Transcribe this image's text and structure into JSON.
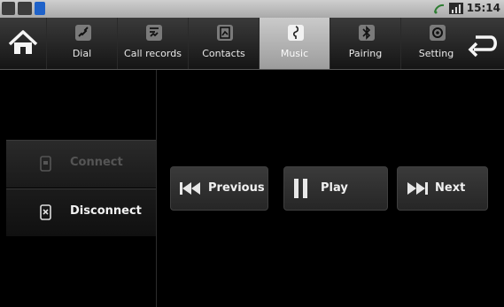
{
  "status": {
    "time": "15:14"
  },
  "nav": {
    "tabs": [
      {
        "label": "Dial",
        "icon": "phone-icon"
      },
      {
        "label": "Call records",
        "icon": "call-records-icon"
      },
      {
        "label": "Contacts",
        "icon": "contacts-icon"
      },
      {
        "label": "Music",
        "icon": "music-icon",
        "active": true
      },
      {
        "label": "Pairing",
        "icon": "bluetooth-icon"
      },
      {
        "label": "Setting",
        "icon": "gear-icon"
      }
    ]
  },
  "side": {
    "connect_label": "Connect",
    "disconnect_label": "Disconnect"
  },
  "controls": {
    "previous_label": "Previous",
    "play_label": "Play",
    "next_label": "Next"
  },
  "colors": {
    "active_tab": "#b4b4b4",
    "background": "#000000"
  }
}
